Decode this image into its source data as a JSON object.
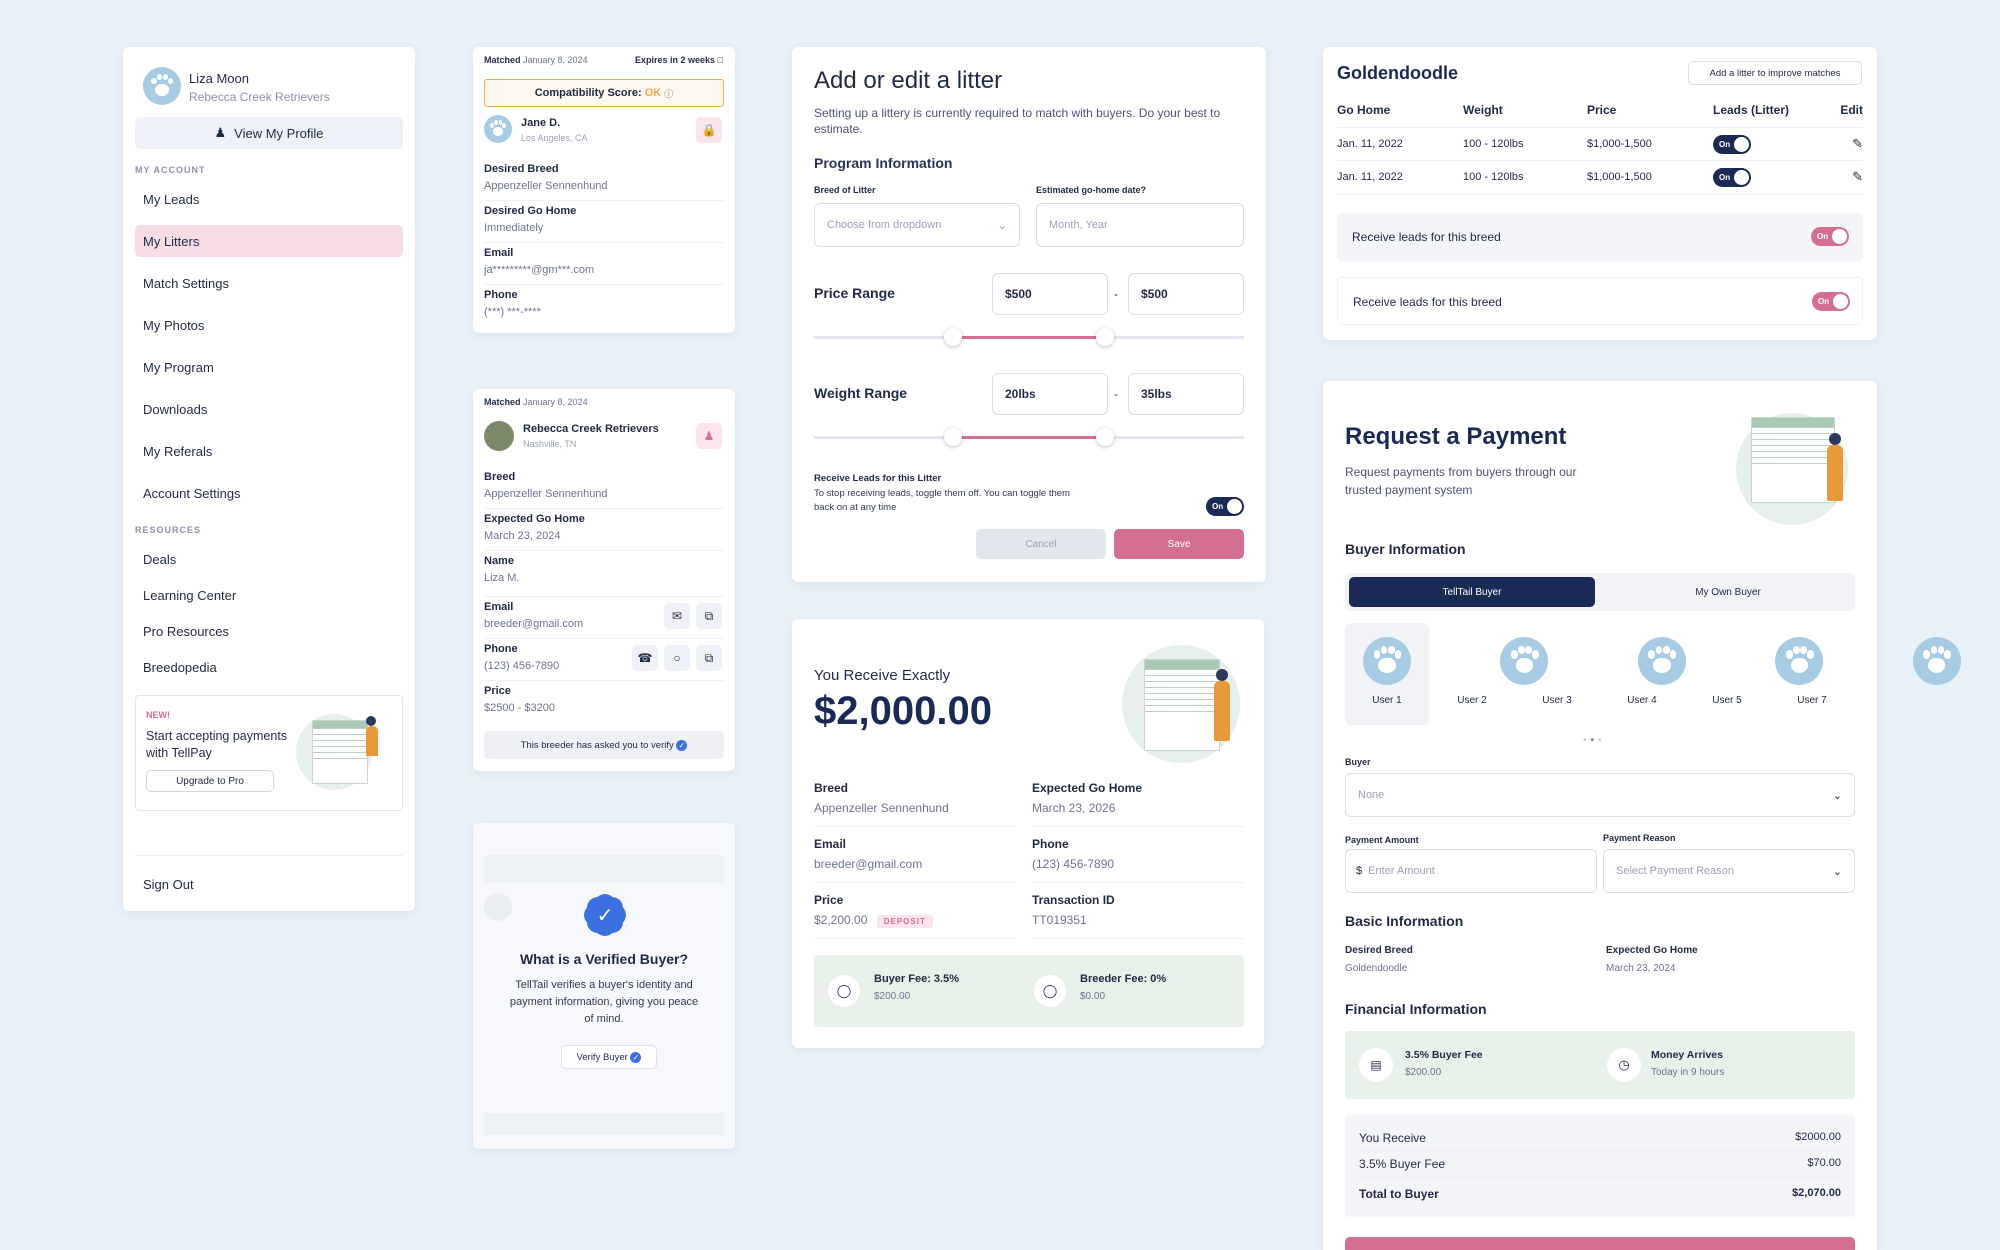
{
  "sidebar": {
    "name": "Liza Moon",
    "kennel": "Rebecca Creek Retrievers",
    "view_profile": "View My Profile",
    "my_account": "MY ACCOUNT",
    "items": [
      "My Leads",
      "My Litters",
      "Match Settings",
      "My Photos",
      "My Program",
      "Downloads",
      "My Referals",
      "Account Settings"
    ],
    "resources": "RESOURCES",
    "resource_items": [
      "Deals",
      "Learning Center",
      "Pro Resources",
      "Breedopedia"
    ],
    "promo_new": "NEW!",
    "promo_text": "Start accepting payments with TellPay",
    "promo_btn": "Upgrade to Pro",
    "sign_out": "Sign Out"
  },
  "match1": {
    "matched": "Matched",
    "date": "January 8, 2024",
    "expires": "Expires in 2 weeks",
    "score_label": "Compatibility Score:",
    "score": "OK",
    "name": "Jane D.",
    "location": "Los Angeles, CA",
    "fields": [
      {
        "l": "Desired Breed",
        "v": "Appenzeller Sennenhund"
      },
      {
        "l": "Desired Go Home",
        "v": "Immediately"
      },
      {
        "l": "Email",
        "v": "ja*********@gm***.com"
      },
      {
        "l": "Phone",
        "v": "(***) ***-****"
      }
    ]
  },
  "match2": {
    "matched": "Matched",
    "date": "January 8, 2024",
    "name": "Rebecca Creek Retrievers",
    "location": "Nashville, TN",
    "fields": [
      {
        "l": "Breed",
        "v": "Appenzeller Sennenhund"
      },
      {
        "l": "Expected Go Home",
        "v": "March 23, 2024"
      },
      {
        "l": "Name",
        "v": "Liza M."
      },
      {
        "l": "Email",
        "v": "breeder@gmail.com"
      },
      {
        "l": "Phone",
        "v": "(123) 456-7890"
      },
      {
        "l": "Price",
        "v": "$2500 - $3200"
      }
    ],
    "verify_note": "This breeder has asked you to verify"
  },
  "verified": {
    "title": "What is a Verified Buyer?",
    "text": "TellTail verifies a buyer's identity and payment information, giving you peace of mind.",
    "btn": "Verify Buyer"
  },
  "litter": {
    "title": "Add or edit a litter",
    "subtitle": "Setting up a littery is currently required to match with buyers. Do your best to estimate.",
    "program": "Program Information",
    "breed_label": "Breed of Litter",
    "breed_ph": "Choose from dropdown",
    "date_label": "Estimated go-home date?",
    "date_ph": "Month, Year",
    "price_range": "Price Range",
    "price_min": "$500",
    "price_max": "$500",
    "weight_range": "Weight Range",
    "weight_min": "20lbs",
    "weight_max": "35lbs",
    "dash": "-",
    "leads_title": "Receive Leads for this Litter",
    "leads_text": "To stop receiving leads, toggle them off. You can toggle them back on at any time",
    "on": "On",
    "cancel": "Cancel",
    "save": "Save"
  },
  "receive": {
    "label": "You Receive Exactly",
    "amount": "$2,000.00",
    "fields": [
      {
        "l": "Breed",
        "v": "Appenzeller Sennenhund"
      },
      {
        "l": "Expected Go Home",
        "v": "March 23, 2026"
      },
      {
        "l": "Email",
        "v": "breeder@gmail.com"
      },
      {
        "l": "Phone",
        "v": "(123) 456-7890"
      },
      {
        "l": "Price",
        "v": "$2,200.00"
      },
      {
        "l": "Transaction ID",
        "v": "TT019351"
      }
    ],
    "deposit": "DEPOSIT",
    "buyer_fee": "Buyer Fee: 3.5%",
    "buyer_fee_v": "$200.00",
    "breeder_fee": "Breeder Fee: 0%",
    "breeder_fee_v": "$0.00"
  },
  "goldendoodle": {
    "title": "Goldendoodle",
    "add_btn": "Add a litter to improve matches",
    "headers": [
      "Go Home",
      "Weight",
      "Price",
      "Leads (Litter)",
      "Edit"
    ],
    "rows": [
      {
        "go": "Jan. 11, 2022",
        "weight": "100 - 120lbs",
        "price": "$1,000-1,500"
      },
      {
        "go": "Jan. 11, 2022",
        "weight": "100 - 120lbs",
        "price": "$1,000-1,500"
      }
    ],
    "breed_leads": "Receive leads for this breed",
    "on": "On"
  },
  "payment": {
    "title": "Request a Payment",
    "subtitle": "Request payments from buyers through our trusted payment system",
    "buyer_info": "Buyer Information",
    "tab1": "TellTail Buyer",
    "tab2": "My Own Buyer",
    "users": [
      "User 1",
      "User 2",
      "User 3",
      "User 4",
      "User 5",
      "User 7"
    ],
    "buyer_label": "Buyer",
    "buyer_ph": "None",
    "amount_label": "Payment Amount",
    "amount_ph": "Enter Amount",
    "currency": "$",
    "reason_label": "Payment Reason",
    "reason_ph": "Select Payment Reason",
    "basic": "Basic Information",
    "desired_breed": "Desired Breed",
    "desired_breed_v": "Goldendoodle",
    "go_home": "Expected Go Home",
    "go_home_v": "March 23, 2024",
    "financial": "Financial Information",
    "fee": "3.5% Buyer Fee",
    "fee_v": "$200.00",
    "arrives": "Money Arrives",
    "arrives_v": "Today in 9 hours",
    "summary": [
      {
        "l": "You Receive",
        "v": "$2000.00"
      },
      {
        "l": "3.5% Buyer Fee",
        "v": "$70.00"
      },
      {
        "l": "Total to Buyer",
        "v": "$2,070.00"
      }
    ]
  },
  "colors": {
    "navy": "#1b2a55",
    "pink": "#d46f8f",
    "active_bg": "#f6dde5",
    "green_bg": "#e7f1ea"
  }
}
